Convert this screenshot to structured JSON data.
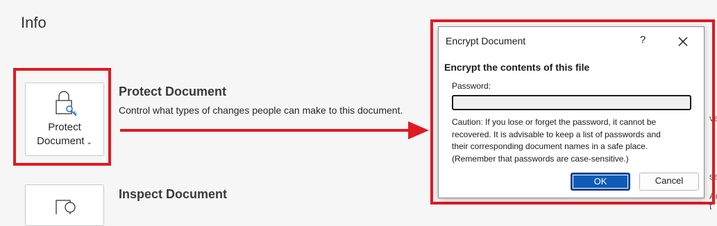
{
  "page": {
    "title": "Info"
  },
  "protect": {
    "button_line1": "Protect",
    "button_line2": "Document",
    "button_chevron": "⌄",
    "title": "Protect Document",
    "description": "Control what types of changes people can make to this document.",
    "icon": "lock-document-icon"
  },
  "inspect": {
    "title": "Inspect Document",
    "icon": "inspect-document-icon"
  },
  "edge_fragments": [
    "ve",
    "se",
    "Add t"
  ],
  "dialog": {
    "title": "Encrypt Document",
    "help": "?",
    "heading": "Encrypt the contents of this file",
    "password_label": "Password:",
    "password_value": "",
    "caution_lines": [
      "Caution: If you lose or forget the password, it cannot be",
      "recovered. It is advisable to keep a list of passwords and",
      "their corresponding document names in a safe place.",
      "(Remember that passwords are case-sensitive.)"
    ],
    "ok_label": "OK",
    "cancel_label": "Cancel"
  },
  "colors": {
    "highlight": "#e01a22",
    "accent": "#0f5bb5"
  }
}
